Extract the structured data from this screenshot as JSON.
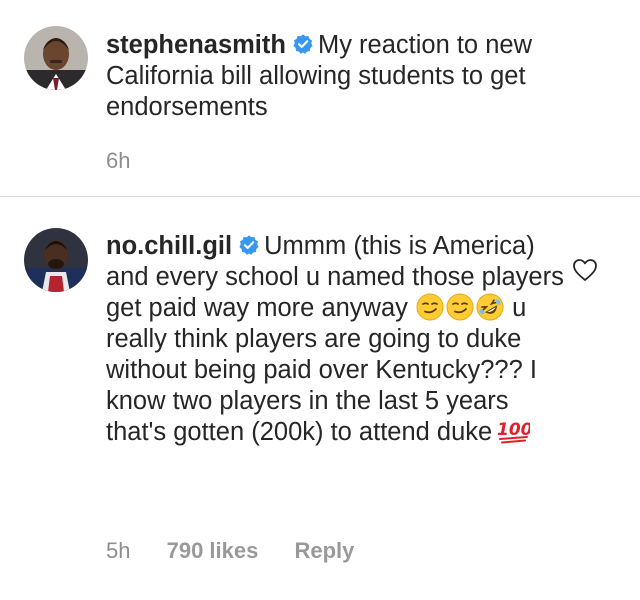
{
  "caption": {
    "username": "stephenasmith",
    "verified": true,
    "text": "My reaction to new California bill allowing students to get endorsements",
    "time": "6h"
  },
  "comment": {
    "username": "no.chill.gil",
    "verified": true,
    "text_part1": "Ummm (this is America) and every school u named those players get paid way more anyway",
    "emojis": [
      "smirking-face",
      "smirking-face",
      "rolling-on-floor-laughing"
    ],
    "text_part2": "u really think players are going to duke without being paid over Kentucky??? I know two players in the last 5 years that's gotten (200k) to attend duke",
    "end_emoji": "hundred-points",
    "time": "5h",
    "likes": "790 likes",
    "reply_label": "Reply"
  },
  "colors": {
    "text": "#262626",
    "meta": "#8e8e8e",
    "verified_blue": "#3897f0",
    "divider": "#dbdbdb"
  }
}
